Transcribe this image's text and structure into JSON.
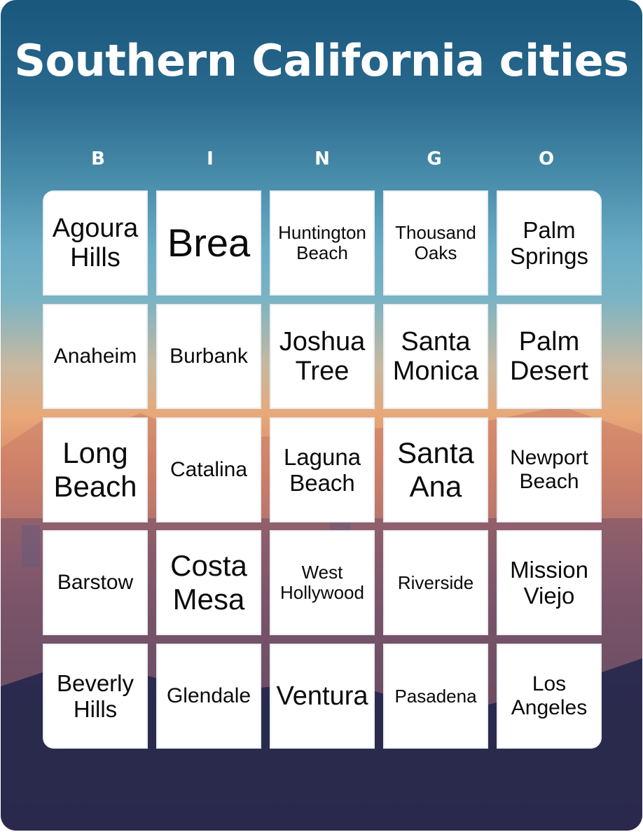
{
  "title": "Southern California cities",
  "header_letters": [
    "B",
    "I",
    "N",
    "G",
    "O"
  ],
  "colors": {
    "background_top": "#19577c",
    "background_mid": "#e8a878",
    "background_bottom": "#1a2248",
    "cell": "#ffffff",
    "text": "#0a0a0a",
    "title": "#ffffff"
  },
  "grid": [
    [
      {
        "text": "Agoura Hills",
        "size": "s-m"
      },
      {
        "text": "Brea",
        "size": "s-xl"
      },
      {
        "text": "Huntington Beach",
        "size": "s-xs"
      },
      {
        "text": "Thousand Oaks",
        "size": "s-xs"
      },
      {
        "text": "Palm Springs",
        "size": "s-sm"
      }
    ],
    [
      {
        "text": "Anaheim",
        "size": "s-s"
      },
      {
        "text": "Burbank",
        "size": "s-s"
      },
      {
        "text": "Joshua Tree",
        "size": "s-m"
      },
      {
        "text": "Santa Monica",
        "size": "s-m"
      },
      {
        "text": "Palm Desert",
        "size": "s-m"
      }
    ],
    [
      {
        "text": "Long Beach",
        "size": "s-l"
      },
      {
        "text": "Catalina",
        "size": "s-s"
      },
      {
        "text": "Laguna Beach",
        "size": "s-sm"
      },
      {
        "text": "Santa Ana",
        "size": "s-l"
      },
      {
        "text": "Newport Beach",
        "size": "s-s"
      }
    ],
    [
      {
        "text": "Barstow",
        "size": "s-s"
      },
      {
        "text": "Costa Mesa",
        "size": "s-l"
      },
      {
        "text": "West Hollywood",
        "size": "s-xs"
      },
      {
        "text": "Riverside",
        "size": "s-xs"
      },
      {
        "text": "Mission Viejo",
        "size": "s-sm"
      }
    ],
    [
      {
        "text": "Beverly Hills",
        "size": "s-sm"
      },
      {
        "text": "Glendale",
        "size": "s-s"
      },
      {
        "text": "Ventura",
        "size": "s-m"
      },
      {
        "text": "Pasadena",
        "size": "s-xs"
      },
      {
        "text": "Los Angeles",
        "size": "s-s"
      }
    ]
  ]
}
